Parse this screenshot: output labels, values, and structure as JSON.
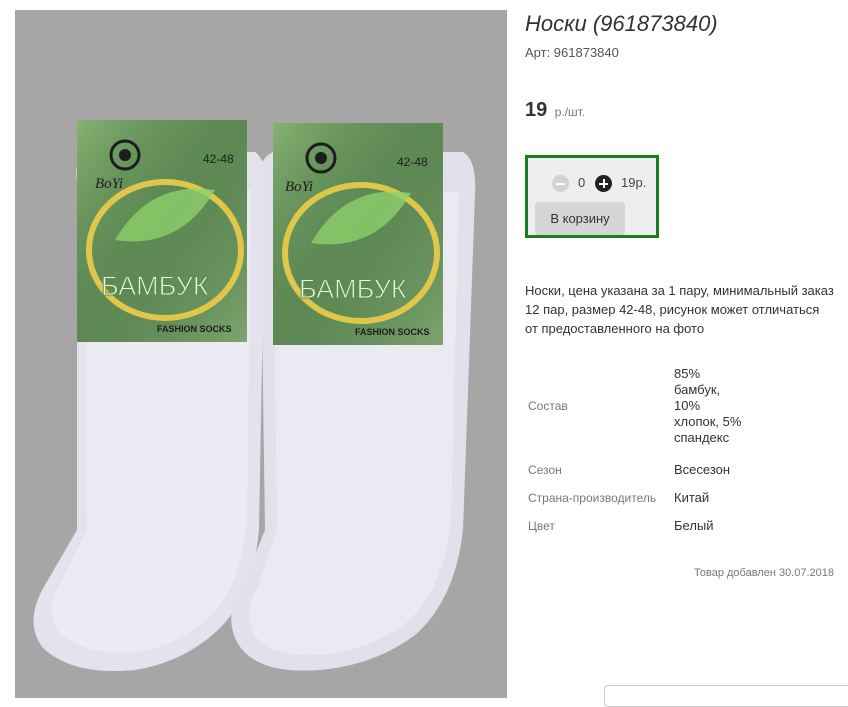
{
  "product": {
    "title": "Носки (961873840)",
    "sku": "Арт: 961873840",
    "price_value": "19",
    "price_unit": "р./шт."
  },
  "cart": {
    "quantity": "0",
    "sum": "19р.",
    "add_button_label": "В корзину"
  },
  "description": "Носки, цена указана за 1 пару, минимальный заказ 12 пар, размер 42-48, рисунок может отличаться от предоставленного на фото",
  "specs": [
    {
      "label": "Состав",
      "value": "85% бамбук, 10% хлопок, 5% спандекс"
    },
    {
      "label": "Сезон",
      "value": "Всесезон"
    },
    {
      "label": "Страна-производитель",
      "value": "Китай"
    },
    {
      "label": "Цвет",
      "value": "Белый"
    }
  ],
  "added_date": "Товар добавлен 30.07.2018",
  "photo": {
    "brand": "BoYi",
    "size_label": "42-48",
    "material_label": "БАМБУК",
    "tagline": "FASHION SOCKS"
  },
  "colors": {
    "accent_border": "#1a7f1a",
    "photo_background": "#a8a5a6"
  }
}
